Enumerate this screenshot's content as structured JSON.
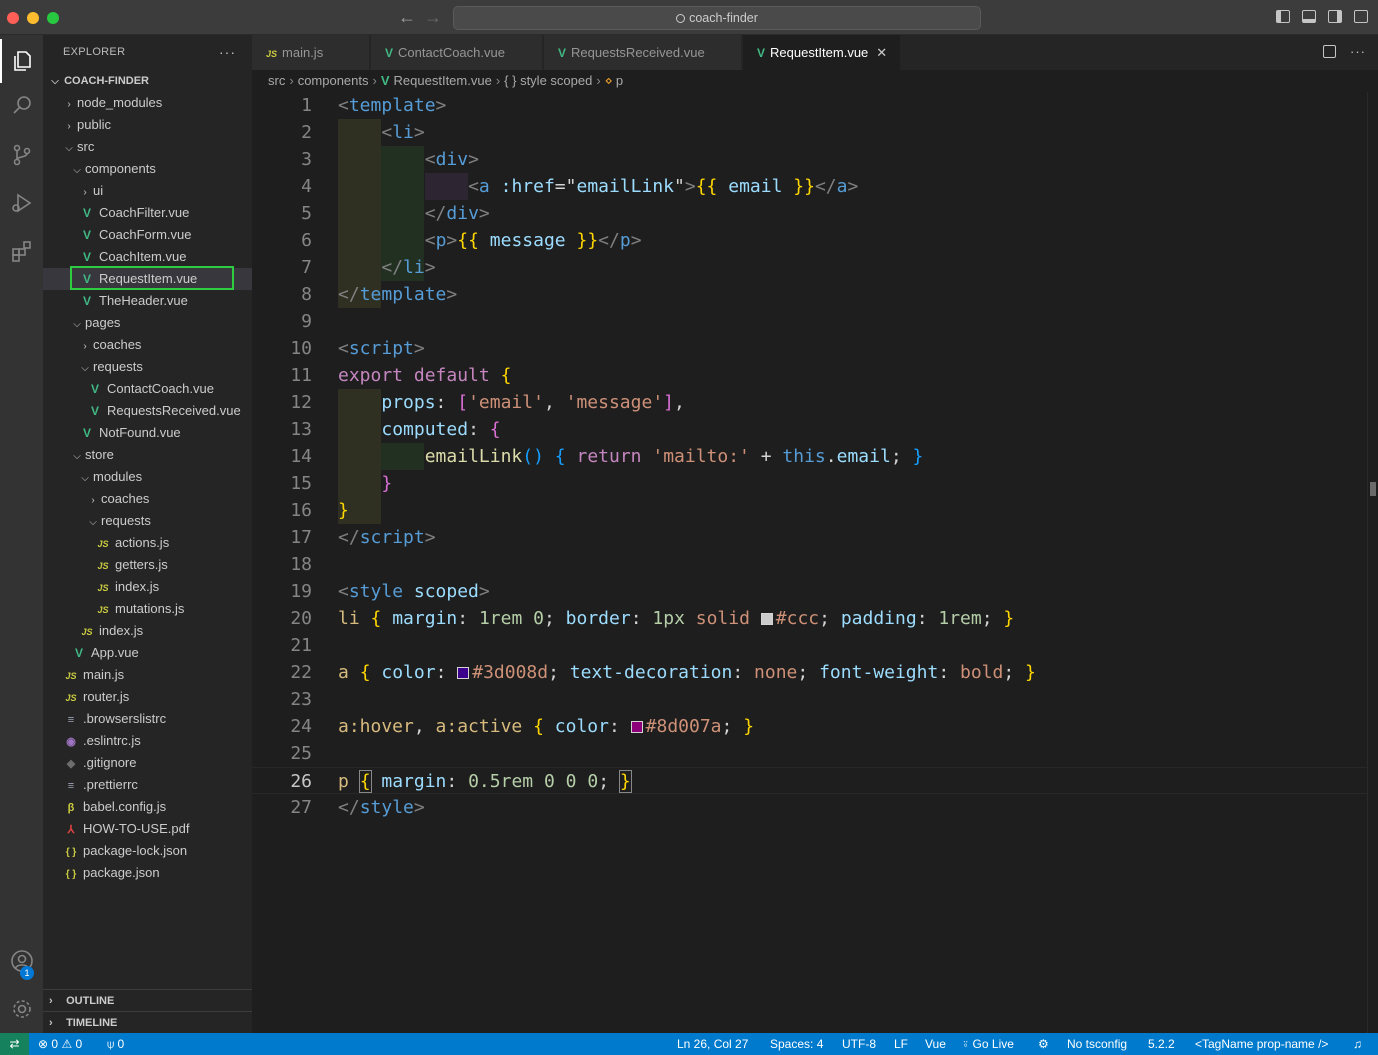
{
  "window": {
    "search_text": "coach-finder"
  },
  "explorer": {
    "title": "EXPLORER",
    "more": "···",
    "root": "COACH-FINDER",
    "items": [
      {
        "label": "node_modules",
        "type": "folder",
        "open": false
      },
      {
        "label": "public",
        "type": "folder",
        "open": false
      },
      {
        "label": "src",
        "type": "folder",
        "open": true
      },
      {
        "label": "components",
        "type": "folder",
        "open": true
      },
      {
        "label": "ui",
        "type": "folder",
        "open": false
      },
      {
        "label": "CoachFilter.vue",
        "type": "vue"
      },
      {
        "label": "CoachForm.vue",
        "type": "vue"
      },
      {
        "label": "CoachItem.vue",
        "type": "vue"
      },
      {
        "label": "RequestItem.vue",
        "type": "vue",
        "selected": true
      },
      {
        "label": "TheHeader.vue",
        "type": "vue"
      },
      {
        "label": "pages",
        "type": "folder",
        "open": true
      },
      {
        "label": "coaches",
        "type": "folder",
        "open": false
      },
      {
        "label": "requests",
        "type": "folder",
        "open": true
      },
      {
        "label": "ContactCoach.vue",
        "type": "vue"
      },
      {
        "label": "RequestsReceived.vue",
        "type": "vue"
      },
      {
        "label": "NotFound.vue",
        "type": "vue"
      },
      {
        "label": "store",
        "type": "folder",
        "open": true
      },
      {
        "label": "modules",
        "type": "folder",
        "open": true
      },
      {
        "label": "coaches",
        "type": "folder",
        "open": false
      },
      {
        "label": "requests",
        "type": "folder",
        "open": true
      },
      {
        "label": "actions.js",
        "type": "js"
      },
      {
        "label": "getters.js",
        "type": "js"
      },
      {
        "label": "index.js",
        "type": "js"
      },
      {
        "label": "mutations.js",
        "type": "js"
      },
      {
        "label": "index.js",
        "type": "js"
      },
      {
        "label": "App.vue",
        "type": "vue"
      },
      {
        "label": "main.js",
        "type": "js"
      },
      {
        "label": "router.js",
        "type": "js"
      },
      {
        "label": ".browserslistrc",
        "type": "cfg"
      },
      {
        "label": ".eslintrc.js",
        "type": "eslint"
      },
      {
        "label": ".gitignore",
        "type": "git"
      },
      {
        "label": ".prettierrc",
        "type": "cfg"
      },
      {
        "label": "babel.config.js",
        "type": "babel"
      },
      {
        "label": "HOW-TO-USE.pdf",
        "type": "pdf"
      },
      {
        "label": "package-lock.json",
        "type": "json"
      },
      {
        "label": "package.json",
        "type": "json"
      }
    ],
    "outline": "OUTLINE",
    "timeline": "TIMELINE"
  },
  "icons": {
    "vue": "V",
    "js": "JS",
    "json": "{ }",
    "cfg": "≡",
    "eslint": "◉",
    "git": "◆",
    "babel": "β",
    "pdf": "⅄"
  },
  "tabs": [
    {
      "label": "main.js",
      "type": "js"
    },
    {
      "label": "ContactCoach.vue",
      "type": "vue"
    },
    {
      "label": "RequestsReceived.vue",
      "type": "vue"
    },
    {
      "label": "RequestItem.vue",
      "type": "vue",
      "active": true
    }
  ],
  "breadcrumbs": [
    "src",
    "components",
    "RequestItem.vue",
    "{ } style scoped",
    "p"
  ],
  "editor": {
    "current_line": 26,
    "lines": [
      [
        [
          "tk-br",
          "<"
        ],
        [
          "tk-tag",
          "template"
        ],
        [
          "tk-br",
          ">"
        ]
      ],
      [
        [
          "tk-br",
          "<"
        ],
        [
          "tk-tag",
          "li"
        ],
        [
          "tk-br",
          ">"
        ]
      ],
      [
        [
          "tk-br",
          "<"
        ],
        [
          "tk-tag",
          "div"
        ],
        [
          "tk-br",
          ">"
        ]
      ],
      [
        [
          "tk-br",
          "<"
        ],
        [
          "tk-tag",
          "a"
        ],
        [
          "tk-pl",
          " "
        ],
        [
          "tk-attr",
          ":href"
        ],
        [
          "tk-pl",
          "=\""
        ],
        [
          "tk-var",
          "emailLink"
        ],
        [
          "tk-pl",
          "\""
        ],
        [
          "tk-br",
          ">"
        ],
        [
          "tk-mus",
          "{{"
        ],
        [
          "tk-pl",
          " "
        ],
        [
          "tk-var",
          "email"
        ],
        [
          "tk-pl",
          " "
        ],
        [
          "tk-mus",
          "}}"
        ],
        [
          "tk-br",
          "</"
        ],
        [
          "tk-tag",
          "a"
        ],
        [
          "tk-br",
          ">"
        ]
      ],
      [
        [
          "tk-br",
          "</"
        ],
        [
          "tk-tag",
          "div"
        ],
        [
          "tk-br",
          ">"
        ]
      ],
      [
        [
          "tk-br",
          "<"
        ],
        [
          "tk-tag",
          "p"
        ],
        [
          "tk-br",
          ">"
        ],
        [
          "tk-mus",
          "{{"
        ],
        [
          "tk-pl",
          " "
        ],
        [
          "tk-var",
          "message"
        ],
        [
          "tk-pl",
          " "
        ],
        [
          "tk-mus",
          "}}"
        ],
        [
          "tk-br",
          "</"
        ],
        [
          "tk-tag",
          "p"
        ],
        [
          "tk-br",
          ">"
        ]
      ],
      [
        [
          "tk-br",
          "</"
        ],
        [
          "tk-tag",
          "li"
        ],
        [
          "tk-br",
          ">"
        ]
      ],
      [
        [
          "tk-br",
          "</"
        ],
        [
          "tk-tag",
          "template"
        ],
        [
          "tk-br",
          ">"
        ]
      ],
      [],
      [
        [
          "tk-br",
          "<"
        ],
        [
          "tk-tag",
          "script"
        ],
        [
          "tk-br",
          ">"
        ]
      ],
      [
        [
          "tk-kw",
          "export"
        ],
        [
          "tk-pl",
          " "
        ],
        [
          "tk-kw",
          "default"
        ],
        [
          "tk-pl",
          " "
        ],
        [
          "tk-b1",
          "{"
        ]
      ],
      [
        [
          "tk-var",
          "props"
        ],
        [
          "tk-pl",
          ": "
        ],
        [
          "tk-b2",
          "["
        ],
        [
          "tk-str",
          "'email'"
        ],
        [
          "tk-pl",
          ", "
        ],
        [
          "tk-str",
          "'message'"
        ],
        [
          "tk-b2",
          "]"
        ],
        [
          "tk-pl",
          ","
        ]
      ],
      [
        [
          "tk-var",
          "computed"
        ],
        [
          "tk-pl",
          ": "
        ],
        [
          "tk-b2",
          "{"
        ]
      ],
      [
        [
          "tk-fn",
          "emailLink"
        ],
        [
          "tk-b3",
          "()"
        ],
        [
          "tk-pl",
          " "
        ],
        [
          "tk-b3",
          "{"
        ],
        [
          "tk-pl",
          " "
        ],
        [
          "tk-kw",
          "return"
        ],
        [
          "tk-pl",
          " "
        ],
        [
          "tk-str",
          "'mailto:'"
        ],
        [
          "tk-pl",
          " + "
        ],
        [
          "tk-blue",
          "this"
        ],
        [
          "tk-pl",
          "."
        ],
        [
          "tk-var",
          "email"
        ],
        [
          "tk-pl",
          "; "
        ],
        [
          "tk-b3",
          "}"
        ]
      ],
      [
        [
          "tk-b2",
          "}"
        ]
      ],
      [
        [
          "tk-b1",
          "}"
        ]
      ],
      [
        [
          "tk-br",
          "</"
        ],
        [
          "tk-tag",
          "script"
        ],
        [
          "tk-br",
          ">"
        ]
      ],
      [],
      [
        [
          "tk-br",
          "<"
        ],
        [
          "tk-tag",
          "style"
        ],
        [
          "tk-pl",
          " "
        ],
        [
          "tk-attr",
          "scoped"
        ],
        [
          "tk-br",
          ">"
        ]
      ],
      [
        [
          "tk-sel",
          "li"
        ],
        [
          "tk-pl",
          " "
        ],
        [
          "tk-b1",
          "{"
        ],
        [
          "tk-pl",
          " "
        ],
        [
          "tk-prop",
          "margin"
        ],
        [
          "tk-pl",
          ": "
        ],
        [
          "tk-num",
          "1rem"
        ],
        [
          "tk-pl",
          " "
        ],
        [
          "tk-num",
          "0"
        ],
        [
          "tk-pl",
          "; "
        ],
        [
          "tk-prop",
          "border"
        ],
        [
          "tk-pl",
          ": "
        ],
        [
          "tk-num",
          "1px"
        ],
        [
          "tk-pl",
          " "
        ],
        [
          "tk-val",
          "solid"
        ],
        [
          "tk-pl",
          " "
        ],
        [
          "swatch",
          "#cccccc"
        ],
        [
          "tk-val",
          "#ccc"
        ],
        [
          "tk-pl",
          "; "
        ],
        [
          "tk-prop",
          "padding"
        ],
        [
          "tk-pl",
          ": "
        ],
        [
          "tk-num",
          "1rem"
        ],
        [
          "tk-pl",
          "; "
        ],
        [
          "tk-b1",
          "}"
        ]
      ],
      [],
      [
        [
          "tk-sel",
          "a"
        ],
        [
          "tk-pl",
          " "
        ],
        [
          "tk-b1",
          "{"
        ],
        [
          "tk-pl",
          " "
        ],
        [
          "tk-prop",
          "color"
        ],
        [
          "tk-pl",
          ": "
        ],
        [
          "swatch",
          "#3d008d"
        ],
        [
          "tk-val",
          "#3d008d"
        ],
        [
          "tk-pl",
          "; "
        ],
        [
          "tk-prop",
          "text-decoration"
        ],
        [
          "tk-pl",
          ": "
        ],
        [
          "tk-val",
          "none"
        ],
        [
          "tk-pl",
          "; "
        ],
        [
          "tk-prop",
          "font-weight"
        ],
        [
          "tk-pl",
          ": "
        ],
        [
          "tk-val",
          "bold"
        ],
        [
          "tk-pl",
          "; "
        ],
        [
          "tk-b1",
          "}"
        ]
      ],
      [],
      [
        [
          "tk-sel",
          "a:hover"
        ],
        [
          "tk-pl",
          ", "
        ],
        [
          "tk-sel",
          "a:active"
        ],
        [
          "tk-pl",
          " "
        ],
        [
          "tk-b1",
          "{"
        ],
        [
          "tk-pl",
          " "
        ],
        [
          "tk-prop",
          "color"
        ],
        [
          "tk-pl",
          ": "
        ],
        [
          "swatch",
          "#8d007a"
        ],
        [
          "tk-val",
          "#8d007a"
        ],
        [
          "tk-pl",
          "; "
        ],
        [
          "tk-b1",
          "}"
        ]
      ],
      [],
      [
        [
          "tk-sel",
          "p"
        ],
        [
          "tk-pl",
          " "
        ],
        [
          "tk-b1",
          "{"
        ],
        [
          "tk-pl",
          " "
        ],
        [
          "tk-prop",
          "margin"
        ],
        [
          "tk-pl",
          ": "
        ],
        [
          "tk-num",
          "0.5rem"
        ],
        [
          "tk-pl",
          " "
        ],
        [
          "tk-num",
          "0"
        ],
        [
          "tk-pl",
          " "
        ],
        [
          "tk-num",
          "0"
        ],
        [
          "tk-pl",
          " "
        ],
        [
          "tk-num",
          "0"
        ],
        [
          "tk-pl",
          "; "
        ],
        [
          "tk-b1",
          "}"
        ]
      ],
      [
        [
          "tk-br",
          "</"
        ],
        [
          "tk-tag",
          "style"
        ],
        [
          "tk-br",
          ">"
        ]
      ]
    ]
  },
  "statusbar": {
    "errors": "0",
    "warnings": "0",
    "ports": "0",
    "position": "Ln 26, Col 27",
    "spaces": "Spaces: 4",
    "encoding": "UTF-8",
    "eol": "LF",
    "language": "Vue",
    "golive": "Go Live",
    "tsconfig": "No tsconfig",
    "version": "5.2.2",
    "snippet": "<TagName prop-name />"
  },
  "accounts_badge": "1"
}
